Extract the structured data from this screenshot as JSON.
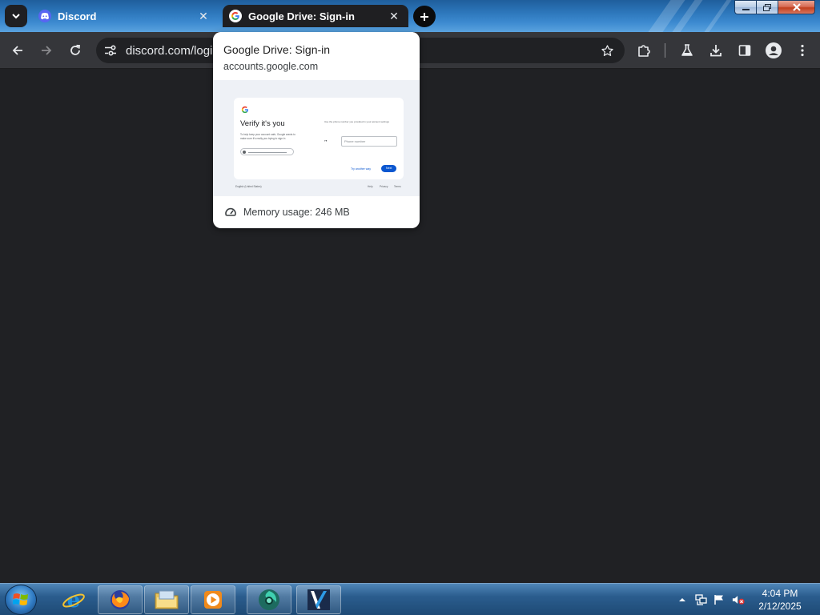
{
  "browser": {
    "tabs": [
      {
        "title": "Discord",
        "favicon": "discord-icon",
        "active": false
      },
      {
        "title": "Google Drive: Sign-in",
        "favicon": "google-g-icon",
        "active": true
      }
    ],
    "address_bar": {
      "url": "discord.com/login"
    },
    "hover_card": {
      "title": "Google Drive: Sign-in",
      "domain": "accounts.google.com",
      "memory_usage": "Memory usage: 246 MB",
      "preview": {
        "heading": "Verify it's you",
        "description": "To help keep your account safe, Google wants to make sure it's really you trying to sign in",
        "right_text": "Use the phone number you provided in your account settings",
        "phone_placeholder": "Phone number",
        "try_another": "Try another way",
        "next_label": "Next",
        "footer_left": "English (United States)",
        "footer_links": [
          "Help",
          "Privacy",
          "Terms"
        ]
      }
    }
  },
  "taskbar": {
    "apps": [
      {
        "name": "internet-explorer-icon"
      },
      {
        "name": "firefox-icon"
      },
      {
        "name": "file-explorer-icon"
      },
      {
        "name": "media-player-icon"
      },
      {
        "name": "chrome-like-icon"
      },
      {
        "name": "video-editor-icon"
      }
    ],
    "clock": {
      "time": "4:04 PM",
      "date": "2/12/2025"
    }
  },
  "colors": {
    "tab_strip": "#2b74b8",
    "toolbar": "#35363a",
    "content": "#202124",
    "google_blue": "#0b57d0",
    "discord_blurple": "#5865f2"
  }
}
